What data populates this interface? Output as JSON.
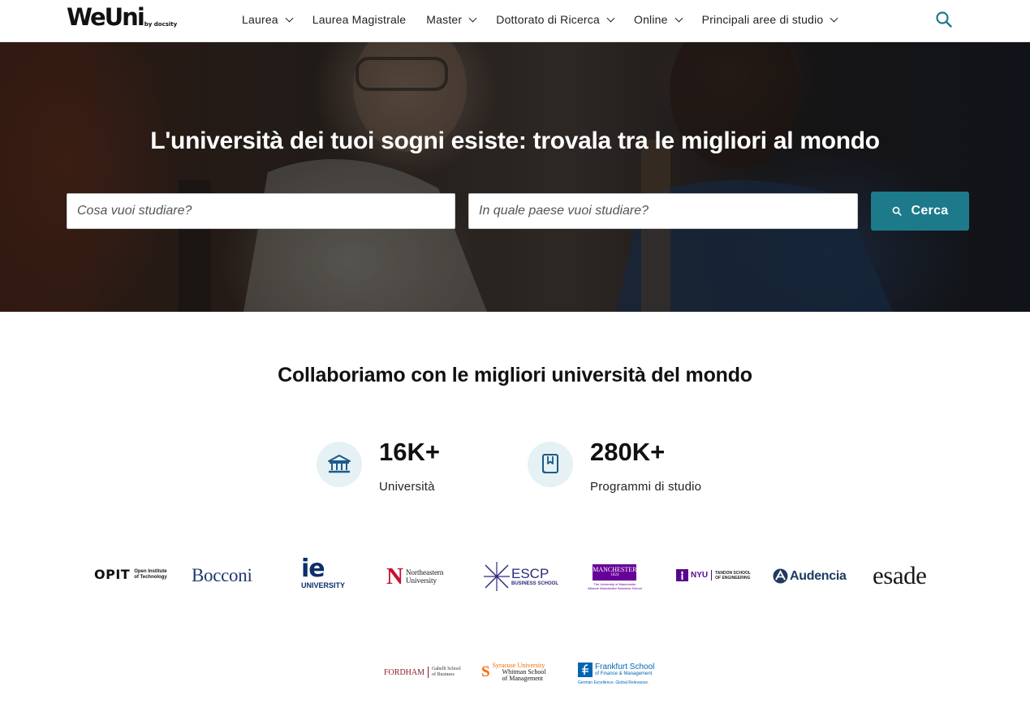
{
  "header": {
    "logo": "WeUni",
    "logo_sub": "by docsity",
    "nav": [
      {
        "label": "Laurea",
        "dropdown": true
      },
      {
        "label": "Laurea Magistrale",
        "dropdown": false
      },
      {
        "label": "Master",
        "dropdown": true
      },
      {
        "label": "Dottorato di Ricerca",
        "dropdown": true
      },
      {
        "label": "Online",
        "dropdown": true
      },
      {
        "label": "Principali aree di studio",
        "dropdown": true
      }
    ],
    "search_icon": "search-icon"
  },
  "hero": {
    "title": "L'università dei tuoi sogni esiste: trovala tra le migliori al mondo",
    "what_placeholder": "Cosa vuoi studiare?",
    "where_placeholder": "In quale paese vuoi studiare?",
    "search_button": "Cerca"
  },
  "partners": {
    "title": "Collaboriamo con le migliori università del mondo",
    "stats": [
      {
        "value": "16K+",
        "label": "Università",
        "icon": "university-building-icon"
      },
      {
        "value": "280K+",
        "label": "Programmi di studio",
        "icon": "book-icon"
      }
    ],
    "logos": {
      "opit": {
        "mark": "OPIT",
        "line1": "Open Institute",
        "line2": "of Technology"
      },
      "bocconi": {
        "name": "Bocconi"
      },
      "ie": {
        "mark": "ie",
        "line1": "UNIVERSITY"
      },
      "northeastern": {
        "mark": "N",
        "line1": "Northeastern",
        "line2": "University"
      },
      "escp": {
        "name": "ESCP",
        "line1": "BUSINESS SCHOOL"
      },
      "manchester": {
        "name": "MANCHESTER",
        "year": "1824",
        "line1": "The University of Manchester",
        "line2": "Alliance Manchester Business School"
      },
      "nyu": {
        "name": "NYU",
        "line1": "TANDON SCHOOL",
        "line2": "OF ENGINEERING"
      },
      "audencia": {
        "name": "Audencia"
      },
      "esade": {
        "name": "esade"
      },
      "fordham": {
        "name": "FORDHAM",
        "line1": "Gabelli School",
        "line2": "of Business"
      },
      "syracuse": {
        "mark": "S",
        "line1": "Syracuse University",
        "line2": "Whitman School",
        "line3": "of Management"
      },
      "frankfurt": {
        "name": "Frankfurt School",
        "line1": "of Finance & Management",
        "line2": "German Excellence. Global Relevance."
      }
    },
    "colors": {
      "accent": "#1d7a8a",
      "icon_bg": "#e5f1f4",
      "bocconi": "#1f3a6e",
      "ie": "#0b2f6b",
      "northeastern": "#c8102e",
      "escp": "#2b2a7a",
      "manchester": "#660099",
      "nyu": "#57068c",
      "audencia": "#1e3a5f",
      "fordham": "#8a1c2b",
      "syracuse": "#f76900",
      "frankfurt": "#0066b3"
    }
  }
}
